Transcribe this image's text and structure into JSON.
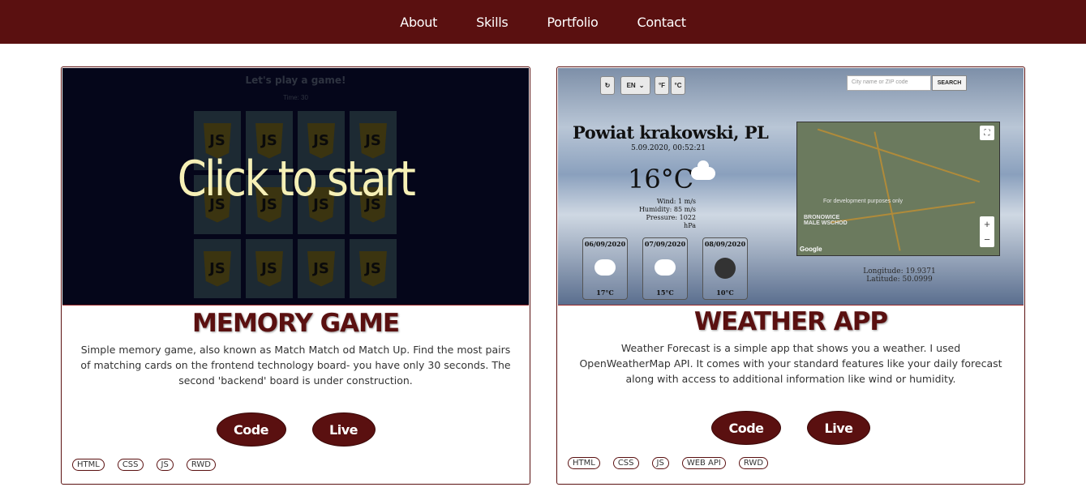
{
  "nav": {
    "items": [
      "About",
      "Skills",
      "Portfolio",
      "Contact"
    ]
  },
  "projects": [
    {
      "title": "MEMORY GAME",
      "description": "Simple memory game, also known as Match Match od Match Up. Find the most pairs of matching cards on the frontend technology board- you have only 30 seconds. The second 'backend' board is under construction.",
      "buttons": {
        "code": "Code",
        "live": "Live"
      },
      "tags": [
        "HTML",
        "CSS",
        "JS",
        "RWD"
      ],
      "preview": {
        "game_title": "Let's play a game!",
        "timer": "Time: 30",
        "card_symbol": "JS",
        "overlay_text": "Click to start"
      }
    },
    {
      "title": "WEATHER APP",
      "description": "Weather Forecast is a simple app that shows you a weather. I used OpenWeatherMap API. It comes with your standard features like your daily forecast along with access to additional information like wind or humidity.",
      "buttons": {
        "code": "Code",
        "live": "Live"
      },
      "tags": [
        "HTML",
        "CSS",
        "JS",
        "WEB API",
        "RWD"
      ],
      "preview": {
        "refresh_symbol": "↻",
        "language": "EN",
        "unit_f": "°F",
        "unit_c": "°C",
        "search_placeholder": "City name or ZIP code",
        "search_button": "SEARCH",
        "city": "Powiat krakowski, PL",
        "datetime": "5.09.2020, 00:52:21",
        "temperature": "16°C",
        "wind": "Wind: 1 m/s",
        "humidity": "Humidity: 85 m/s",
        "pressure": "Pressure: 1022 hPa",
        "map_note": "For development purposes only",
        "map_place": "BRONOWICE MALE WSCHOD",
        "map_google": "Google",
        "longitude": "Longitude: 19.9371",
        "latitude": "Latitude: 50.0999",
        "forecast": [
          {
            "date": "06/09/2020",
            "temp": "17°C",
            "icon": "rain-cloud-icon"
          },
          {
            "date": "07/09/2020",
            "temp": "15°C",
            "icon": "rain-cloud-icon"
          },
          {
            "date": "08/09/2020",
            "temp": "10°C",
            "icon": "night-icon"
          }
        ]
      }
    }
  ],
  "colors": {
    "brand": "#5a1010",
    "game_bg": "#05061a",
    "start_text": "#f6f0b6"
  }
}
